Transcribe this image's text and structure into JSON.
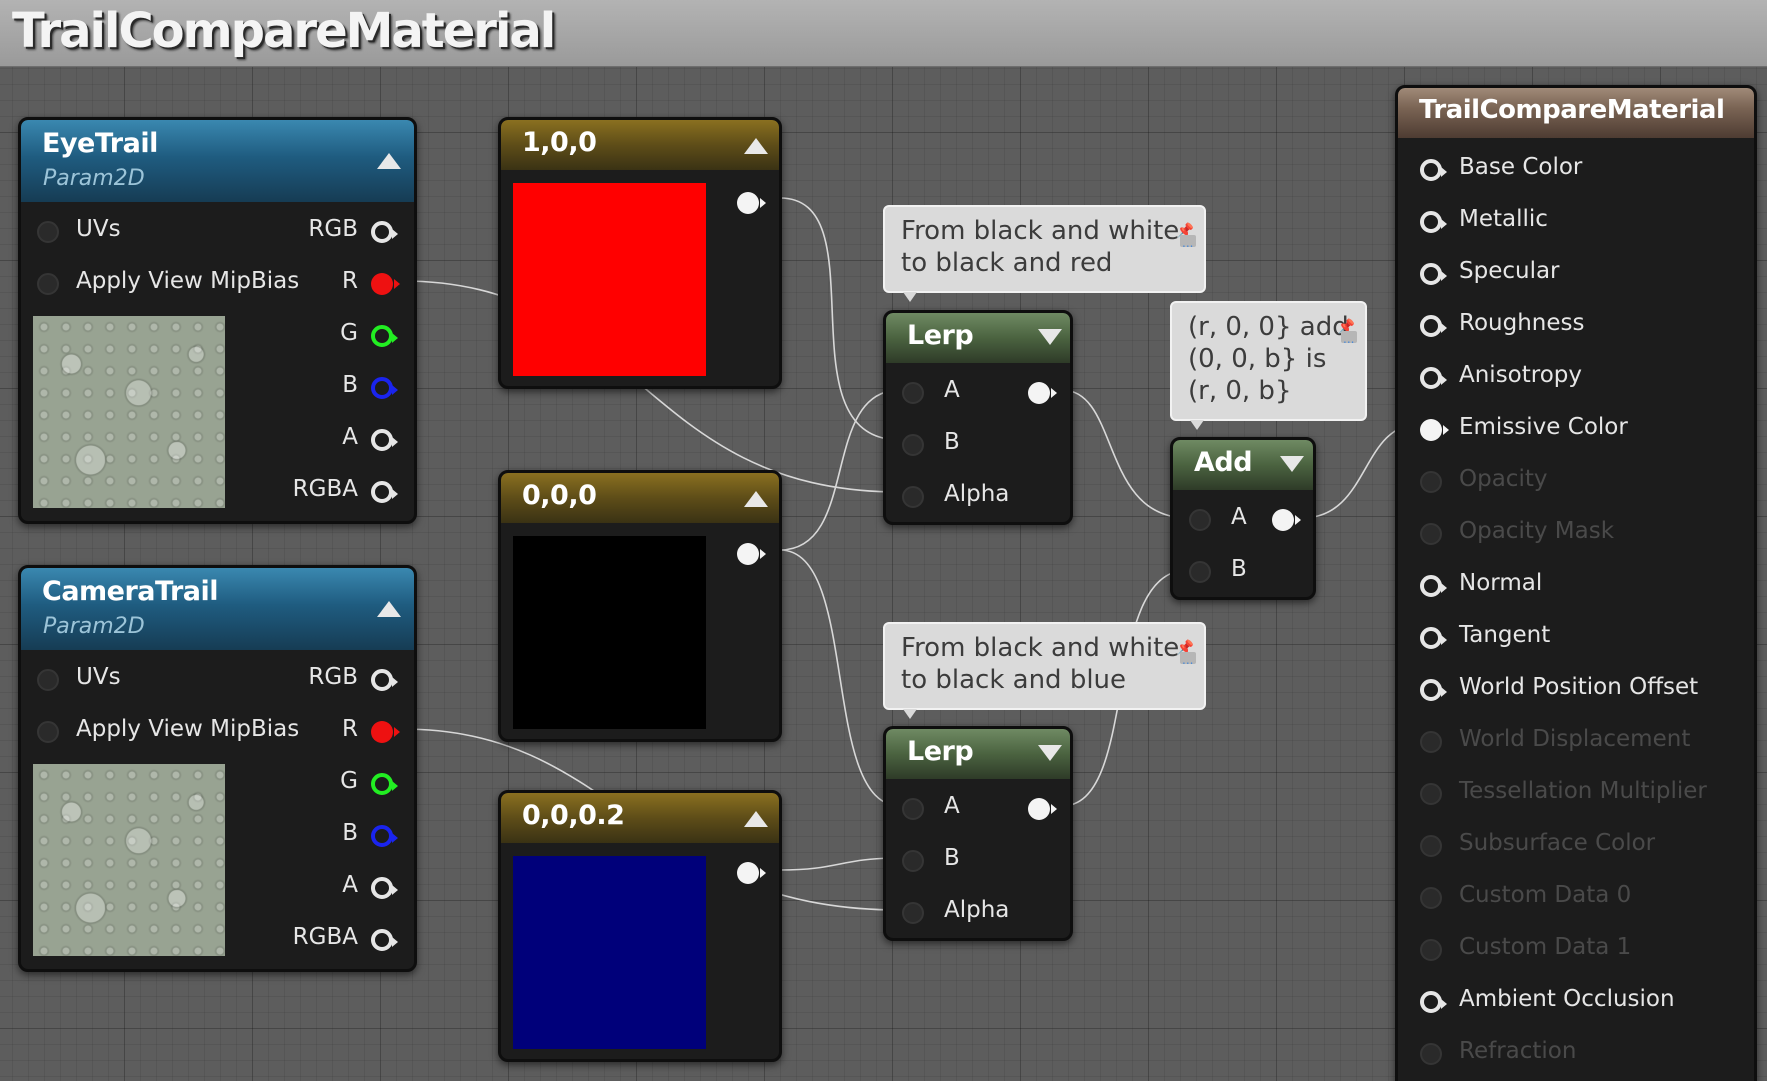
{
  "window": {
    "title": "TrailCompareMaterial"
  },
  "nodes": {
    "eyetrail": {
      "title": "EyeTrail",
      "subtitle": "Param2D",
      "inputs": [
        "UVs",
        "Apply View MipBias"
      ],
      "outputs": [
        "RGB",
        "R",
        "G",
        "B",
        "A",
        "RGBA"
      ]
    },
    "cameratrail": {
      "title": "CameraTrail",
      "subtitle": "Param2D",
      "inputs": [
        "UVs",
        "Apply View MipBias"
      ],
      "outputs": [
        "RGB",
        "R",
        "G",
        "B",
        "A",
        "RGBA"
      ]
    },
    "const_red": {
      "title": "1,0,0",
      "color": "#ff0000"
    },
    "const_black": {
      "title": "0,0,0",
      "color": "#000000"
    },
    "const_blue": {
      "title": "0,0,0.2",
      "color": "#00007a"
    },
    "lerp_top": {
      "title": "Lerp",
      "inputs": [
        "A",
        "B",
        "Alpha"
      ]
    },
    "lerp_bottom": {
      "title": "Lerp",
      "inputs": [
        "A",
        "B",
        "Alpha"
      ]
    },
    "add": {
      "title": "Add",
      "inputs": [
        "A",
        "B"
      ]
    },
    "result": {
      "title": "TrailCompareMaterial",
      "pins": [
        {
          "label": "Base Color",
          "enabled": true
        },
        {
          "label": "Metallic",
          "enabled": true
        },
        {
          "label": "Specular",
          "enabled": true
        },
        {
          "label": "Roughness",
          "enabled": true
        },
        {
          "label": "Anisotropy",
          "enabled": true
        },
        {
          "label": "Emissive Color",
          "enabled": true,
          "connected": true
        },
        {
          "label": "Opacity",
          "enabled": false
        },
        {
          "label": "Opacity Mask",
          "enabled": false
        },
        {
          "label": "Normal",
          "enabled": true
        },
        {
          "label": "Tangent",
          "enabled": true
        },
        {
          "label": "World Position Offset",
          "enabled": true
        },
        {
          "label": "World Displacement",
          "enabled": false
        },
        {
          "label": "Tessellation Multiplier",
          "enabled": false
        },
        {
          "label": "Subsurface Color",
          "enabled": false
        },
        {
          "label": "Custom Data 0",
          "enabled": false
        },
        {
          "label": "Custom Data 1",
          "enabled": false
        },
        {
          "label": "Ambient Occlusion",
          "enabled": true
        },
        {
          "label": "Refraction",
          "enabled": false
        }
      ]
    }
  },
  "comments": {
    "lerp_top": "From black and white\nto black and red",
    "lerp_bottom": "From black and white\nto black and blue",
    "add": "(r, 0, 0} add\n(0, 0, b} is\n(r, 0, b}"
  },
  "icons": {
    "collapse": "triangle-up",
    "expand": "triangle-down",
    "comment_pin": "pin-icon",
    "comment_bubble": "comment-bubble-icon"
  },
  "colors": {
    "graph_bg": "#5d5d5d",
    "texture_header": "#1f5c80",
    "constant_header": "#5e4d18",
    "math_header": "#4b6340",
    "result_header": "#7a6454",
    "pin_red": "#ee1111",
    "pin_green": "#22ee22",
    "pin_blue": "#1a24ee"
  }
}
